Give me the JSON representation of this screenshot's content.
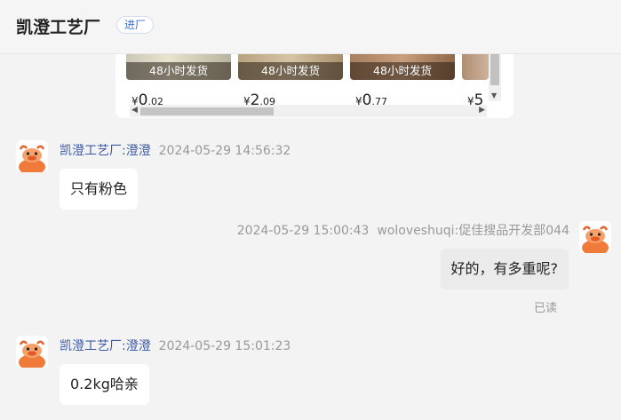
{
  "header": {
    "title": "凯澄工艺厂",
    "badge": "进厂"
  },
  "products": [
    {
      "tag": "48小时发货",
      "currency": "¥",
      "int": "0",
      "dec": ".02"
    },
    {
      "tag": "48小时发货",
      "currency": "¥",
      "int": "2",
      "dec": ".09"
    },
    {
      "tag": "48小时发货",
      "currency": "¥",
      "int": "0",
      "dec": ".77"
    },
    {
      "tag": "",
      "currency": "¥",
      "int": "5",
      "dec": ""
    }
  ],
  "messages": [
    {
      "sender": "凯澄工艺厂:澄澄",
      "time": "2024-05-29 14:56:32",
      "text": "只有粉色"
    },
    {
      "sender": "woloveshuqi:促佳搜品开发部044",
      "time": "2024-05-29 15:00:43",
      "text": "好的，有多重呢?",
      "status": "已读"
    },
    {
      "sender": "凯澄工艺厂:澄澄",
      "time": "2024-05-29 15:01:23",
      "text": "0.2kg哈亲"
    }
  ],
  "colors": {
    "sender_blue": "#3a58a5",
    "badge_blue": "#3f6fd0",
    "avatar_orange": "#f07a3a"
  },
  "icons": [
    "cow-avatar-icon",
    "scroll-arrow-icon"
  ]
}
